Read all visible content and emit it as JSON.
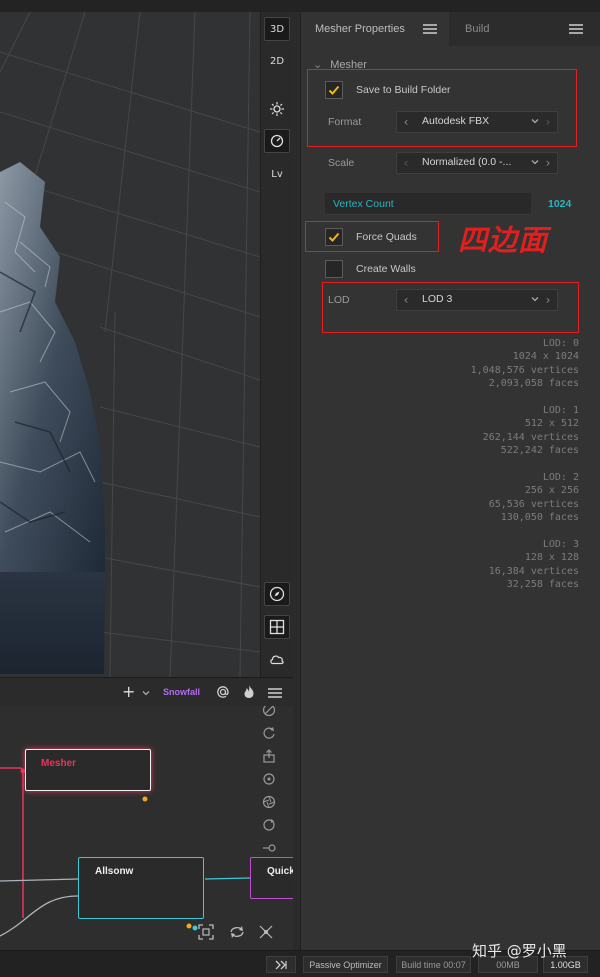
{
  "viewport": {
    "toolbar": [
      {
        "label": "3D",
        "icon": "3d-view-icon",
        "active": true
      },
      {
        "label": "2D",
        "icon": "2d-view-icon",
        "active": false
      },
      {
        "label": "",
        "icon": "sun-icon",
        "active": false
      },
      {
        "label": "",
        "icon": "gauge-icon",
        "active": true
      },
      {
        "label": "Lv",
        "icon": "level-icon",
        "active": false
      }
    ],
    "bottom_tools": [
      "compass-icon",
      "grid-icon",
      "cloud-icon"
    ]
  },
  "panel": {
    "tabs": [
      {
        "label": "Mesher Properties",
        "active": true
      },
      {
        "label": "Build",
        "active": false
      }
    ],
    "section_title": "Mesher",
    "save_to_build_folder": {
      "label": "Save to Build Folder",
      "checked": true
    },
    "format": {
      "label": "Format",
      "value": "Autodesk FBX"
    },
    "scale": {
      "label": "Scale",
      "value": "Normalized (0.0 -..."
    },
    "vertex_count": {
      "label": "Vertex Count",
      "value": "1024"
    },
    "force_quads": {
      "label": "Force Quads",
      "checked": true
    },
    "create_walls": {
      "label": "Create Walls",
      "checked": false
    },
    "lod": {
      "label": "LOD",
      "value": "LOD 3"
    },
    "lod_info": [
      {
        "lod": "LOD: 0",
        "resolution": "1024 x 1024",
        "vertices": "1,048,576 vertices",
        "faces": "2,093,058 faces"
      },
      {
        "lod": "LOD: 1",
        "resolution": "512 x 512",
        "vertices": "262,144 vertices",
        "faces": "522,242 faces"
      },
      {
        "lod": "LOD: 2",
        "resolution": "256 x 256",
        "vertices": "65,536 vertices",
        "faces": "130,050 faces"
      },
      {
        "lod": "LOD: 3",
        "resolution": "128 x 128",
        "vertices": "16,384 vertices",
        "faces": "32,258 faces"
      }
    ],
    "annotation": "四边面"
  },
  "graph": {
    "header": {
      "add_label": "+",
      "project": "Snowfall"
    },
    "nodes": [
      {
        "title": "Mesher",
        "color": "#e8365a"
      },
      {
        "title": "Allsonw",
        "color": "#3ec9d6"
      },
      {
        "title": "Quicke",
        "color": "#c04fd0"
      }
    ],
    "tools": [
      "no-entry-icon",
      "rotate-icon",
      "export-icon",
      "crosshair-icon",
      "shutter-icon",
      "loop-icon",
      "key-icon"
    ]
  },
  "statusbar": {
    "passive_optimizer": "Passive Optimizer",
    "build_time": "Build time 00:07",
    "memory_used": "00MB",
    "memory_total": "1.00GB"
  },
  "watermark": "知乎 @罗小黑",
  "colors": {
    "accent_teal": "#2ab3c4",
    "accent_pink": "#e8365a",
    "accent_purple": "#b36cf0",
    "highlight_red": "#e02020",
    "check_yellow": "#f2b418"
  }
}
